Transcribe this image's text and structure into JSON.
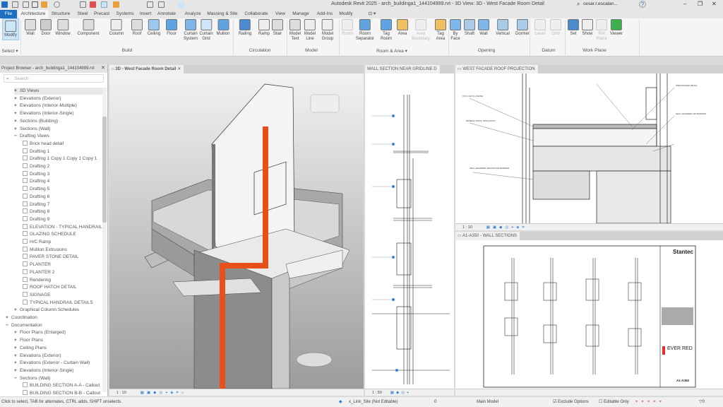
{
  "window": {
    "title": "Autodesk Revit 2025 - arch_buildinga1_144104999.rvt - 3D View: 3D - West Facade Room Detail",
    "user": "cesar.r.escalan...",
    "help": "?",
    "minimize": "–",
    "restore": "❐",
    "close": "✕"
  },
  "tabs": [
    "File",
    "Architecture",
    "Structure",
    "Steel",
    "Precast",
    "Systems",
    "Insert",
    "Annotate",
    "Analyze",
    "Massing & Site",
    "Collaborate",
    "View",
    "Manage",
    "Add-Ins",
    "Modify",
    "⊡ ▾"
  ],
  "active_tab": "Architecture",
  "ribbon": {
    "buttons": [
      "Modify",
      "Wall",
      "Door",
      "Window",
      "Component",
      "Column",
      "Roof",
      "Ceiling",
      "Floor",
      "Curtain\nSystem",
      "Curtain\nGrid",
      "Mullion",
      "Railing",
      "Ramp",
      "Stair",
      "Model\nText",
      "Model\nLine",
      "Model\nGroup",
      "Room",
      "Room\nSeparator",
      "Tag\nRoom",
      "Area",
      "Area\nBoundary",
      "Tag\nArea",
      "By\nFace",
      "Shaft",
      "Wall",
      "Vertical",
      "Dormer",
      "Level",
      "Grid",
      "Set",
      "Show",
      "Ref\nPlane",
      "Viewer"
    ],
    "disabled": [
      "Room",
      "Area\nBoundary",
      "Level",
      "Grid",
      "Ref\nPlane"
    ],
    "panels": [
      "Select ▾",
      "Build",
      "Circulation",
      "Model",
      "Room & Area ▾",
      "Opening",
      "Datum",
      "Work Plane"
    ]
  },
  "project_browser": {
    "title": "Project Browser - arch_buildinga1_144104999.rvt",
    "search_placeholder": "Search",
    "items": [
      {
        "label": "3D Views",
        "level": 1,
        "state": "+"
      },
      {
        "label": "Elevations (Exterior)",
        "level": 1,
        "state": "+"
      },
      {
        "label": "Elevations (Interior-Multiple)",
        "level": 1,
        "state": "+"
      },
      {
        "label": "Elevations (Interior-Single)",
        "level": 1,
        "state": "+"
      },
      {
        "label": "Sections (Building)",
        "level": 1,
        "state": "+"
      },
      {
        "label": "Sections (Wall)",
        "level": 1,
        "state": "+"
      },
      {
        "label": "Drafting Views",
        "level": 1,
        "state": "−"
      },
      {
        "label": "Brick head detail",
        "level": 2
      },
      {
        "label": "Drafting 1",
        "level": 2
      },
      {
        "label": "Drafting 1 Copy 1 Copy 1 Copy 1",
        "level": 2
      },
      {
        "label": "Drafting 2",
        "level": 2
      },
      {
        "label": "Drafting 3",
        "level": 2
      },
      {
        "label": "Drafting 4",
        "level": 2
      },
      {
        "label": "Drafting 5",
        "level": 2
      },
      {
        "label": "Drafting 6",
        "level": 2
      },
      {
        "label": "Drafting 7",
        "level": 2
      },
      {
        "label": "Drafting 8",
        "level": 2
      },
      {
        "label": "Drafting 9",
        "level": 2
      },
      {
        "label": "ELEVATION - TYPICAL HANDRAIL",
        "level": 2
      },
      {
        "label": "GLAZING SCHEDULE",
        "level": 2
      },
      {
        "label": "H/C Ramp",
        "level": 2
      },
      {
        "label": "Mullion Extrusions",
        "level": 2
      },
      {
        "label": "PAVER STONE DETAIL",
        "level": 2
      },
      {
        "label": "PLANTER",
        "level": 2
      },
      {
        "label": "PLANTER 2",
        "level": 2
      },
      {
        "label": "Rendering",
        "level": 2
      },
      {
        "label": "ROOF HATCH DETAIL",
        "level": 2
      },
      {
        "label": "SIGNAGE",
        "level": 2
      },
      {
        "label": "TYPICAL HANDRAIL DETAILS",
        "level": 2
      },
      {
        "label": "Graphical Column Schedules",
        "level": 1,
        "state": "+"
      },
      {
        "label": "Coordination",
        "level": 0,
        "state": "+"
      },
      {
        "label": "Documentation",
        "level": 0,
        "state": "−"
      },
      {
        "label": "Floor Plans (Enlarged)",
        "level": 1,
        "state": "+"
      },
      {
        "label": "Floor Plans",
        "level": 1,
        "state": "+"
      },
      {
        "label": "Ceiling Plans",
        "level": 1,
        "state": "+"
      },
      {
        "label": "Elevations (Exterior)",
        "level": 1,
        "state": "+"
      },
      {
        "label": "Elevations (Exterior - Curtain Wall)",
        "level": 1,
        "state": "+"
      },
      {
        "label": "Elevations (Interior-Single)",
        "level": 1,
        "state": "+"
      },
      {
        "label": "Sections (Wall)",
        "level": 1,
        "state": "−"
      },
      {
        "label": "BUILDING SECTION A-A - Callout",
        "level": 2
      },
      {
        "label": "BUILDING SECTION B-B - Callout",
        "level": 2
      }
    ]
  },
  "views": {
    "v3d": {
      "title": "3D - West Facade Room Detail",
      "scale": "1 : 10"
    },
    "wall_section": {
      "title": "WALL SECTION NEAR GRIDLINE D",
      "scale": "1 : 50"
    },
    "roof": {
      "title": "WEST FACADE ROOF PROJECTION",
      "scale": "1 : 10"
    },
    "sheet": {
      "title": "A1-A350 - WALL SECTIONS",
      "logo": "Stantec",
      "client": "EVER RED",
      "sheet_no": "A1-A350"
    }
  },
  "status": {
    "hint": "Click to select, TAB for alternates, CTRL adds, SHIFT unselects.",
    "workset": "x_Link_Site (Not Editable)",
    "selection_count": "0",
    "design_option": "Main Model",
    "exclude_options": "Exclude Options",
    "editable_only": "Editable Only",
    "filter_count": "0"
  },
  "colors": {
    "accent": "#1e6fc1",
    "pipe": "#e8501a"
  }
}
